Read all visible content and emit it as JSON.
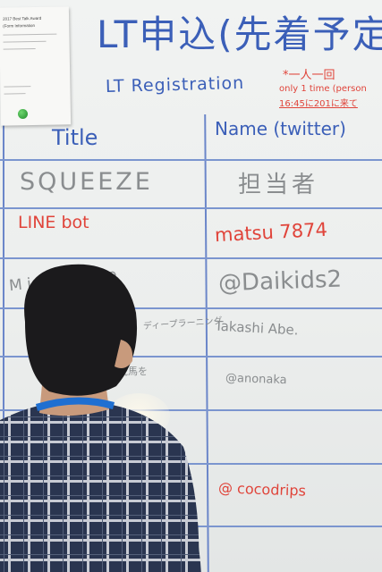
{
  "board": {
    "heading_jp": "LT申込(先着予定",
    "heading_en": "LT Registration",
    "note_line1": "*一人一回",
    "note_line2": "only 1 time (person",
    "note_line3": "16:45に201に来て",
    "col_title": "Title",
    "col_name": "Name (twitter)",
    "rows": [
      {
        "title": "SQUEEZE",
        "name": "担当者",
        "title_color": "gray",
        "name_color": "gray"
      },
      {
        "title": "LINE bot",
        "name": "matsu 7874",
        "title_color": "red",
        "name_color": "red"
      },
      {
        "title": "M        id Everyone",
        "name": "@Daikids2",
        "title_color": "gray",
        "name_color": "gray"
      },
      {
        "title": "ディープラーニング",
        "name": "Takashi Abe.",
        "title_color": "gray",
        "name_color": "gray"
      },
      {
        "title": "荒馬を",
        "name": "@anonaka",
        "title_color": "gray",
        "name_color": "gray"
      },
      {
        "title": "",
        "name": "@ cocodrips",
        "title_color": "gray",
        "name_color": "red"
      }
    ]
  },
  "flyer": {
    "lines": [
      "2017 Best Talk Award",
      "(Form Information",
      "",
      "",
      "",
      "",
      "",
      ""
    ]
  },
  "colors": {
    "board": "#eceeed",
    "marker_blue": "#3b5fb8",
    "marker_red": "#e0443a",
    "marker_gray": "#8a8d8f",
    "shirt": "#2a3550",
    "lanyard": "#1f6fd1"
  }
}
